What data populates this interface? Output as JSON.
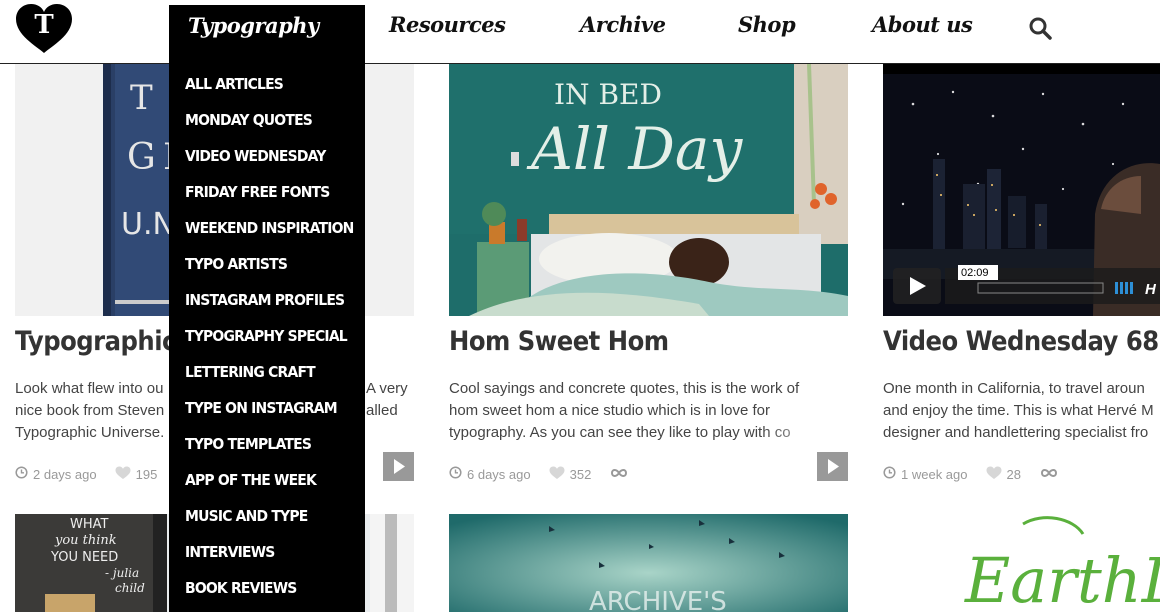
{
  "header": {
    "logo_letter": "T",
    "nav": [
      "Resources",
      "Archive",
      "Shop",
      "About us"
    ]
  },
  "dropdown": {
    "title": "Typography",
    "items": [
      "ALL ARTICLES",
      "MONDAY QUOTES",
      "VIDEO WEDNESDAY",
      "FRIDAY FREE FONTS",
      "WEEKEND INSPIRATION",
      "TYPO ARTISTS",
      "INSTAGRAM PROFILES",
      "TYPOGRAPHY SPECIAL",
      "LETTERING CRAFT",
      "TYPE ON INSTAGRAM",
      "TYPO TEMPLATES",
      "APP OF THE WEEK",
      "MUSIC AND TYPE",
      "INTERVIEWS",
      "BOOK REVIEWS"
    ]
  },
  "cards": [
    {
      "title": "Typographic U",
      "excerpt": [
        "Look what flew into ou",
        "nice book from Steven",
        "Typographic Universe."
      ],
      "excerpt_right": [
        "A very",
        "alled",
        ""
      ],
      "time": "2 days ago",
      "likes": "195"
    },
    {
      "title": "Hom Sweet Hom",
      "image_text": [
        "IN BED",
        "All Day"
      ],
      "excerpt": [
        "Cool sayings and concrete quotes, this is the work of",
        "hom sweet hom a nice studio which is in love for",
        "typography. As you can see they like to play with co"
      ],
      "time": "6 days ago",
      "likes": "352"
    },
    {
      "title": "Video Wednesday 68",
      "video_time": "02:09",
      "video_hd": "H",
      "excerpt": [
        "One month in California, to travel aroun",
        "and enjoy the time. This is what Hervé M",
        "designer and handlettering specialist fro"
      ],
      "time": "1 week ago",
      "likes": "28"
    }
  ],
  "bottom_row": {
    "card4_image_text": [
      "WHAT",
      "you think",
      "YOU NEED",
      "- julia",
      "child"
    ],
    "card6_image_text": "EarthDa"
  },
  "colors": {
    "dropdown_bg": "#000000",
    "meta_grey": "#999999",
    "card2_wall": "#1e6d6a",
    "card6_green": "#5ab03c"
  }
}
